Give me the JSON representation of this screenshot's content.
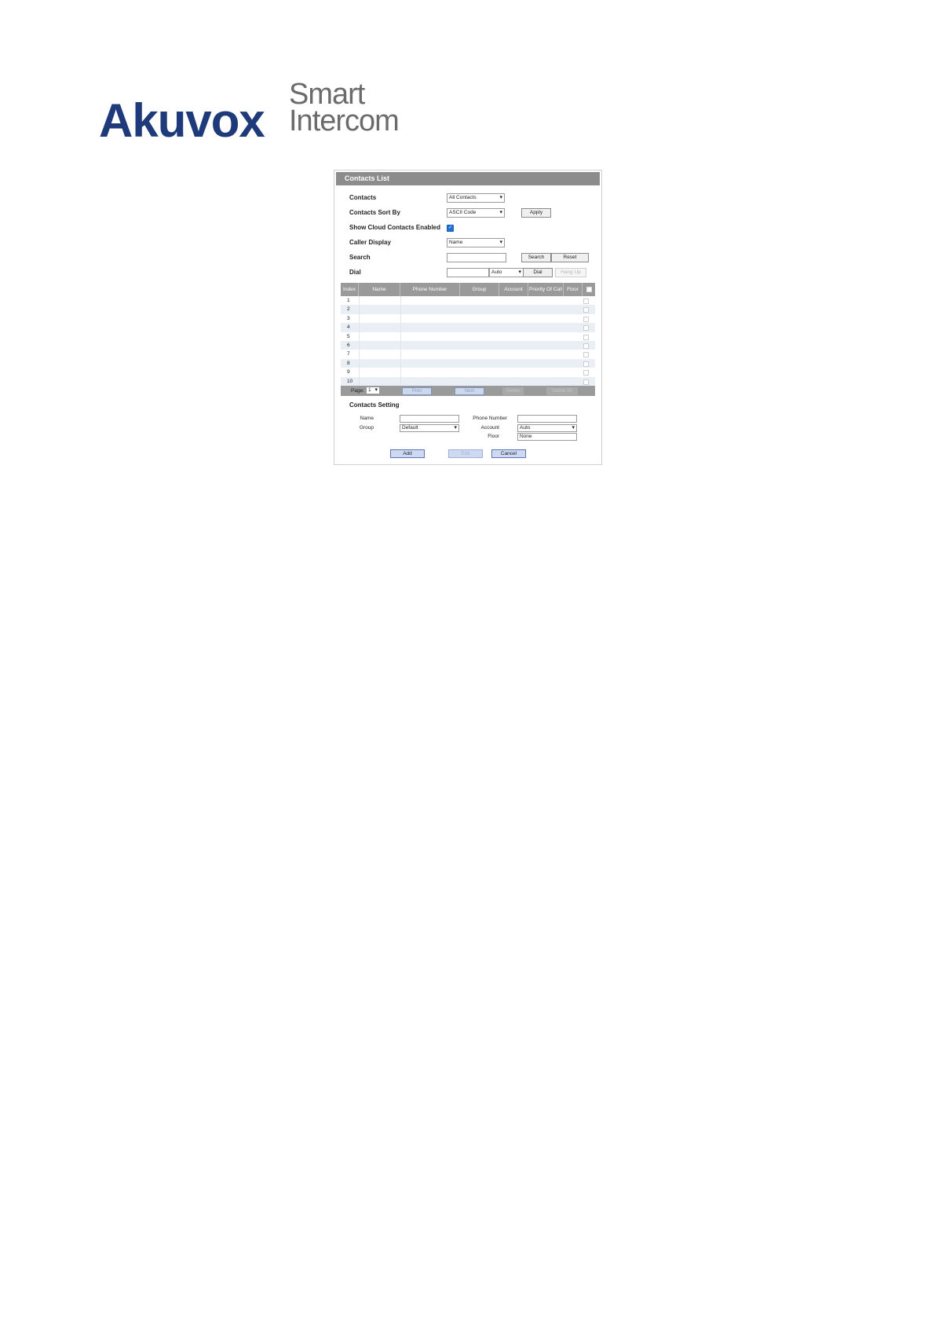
{
  "logo": {
    "brand": "Akuvox",
    "line1": "Smart",
    "line2": "Intercom"
  },
  "panel": {
    "title": "Contacts List",
    "form": {
      "contacts": {
        "label": "Contacts",
        "value": "All Contacts"
      },
      "sort_by": {
        "label": "Contacts Sort By",
        "value": "ASCII Code",
        "apply_label": "Apply"
      },
      "show_cloud": {
        "label": "Show Cloud Contacts Enabled",
        "checked": true
      },
      "caller_display": {
        "label": "Caller Display",
        "value": "Name"
      },
      "search": {
        "label": "Search",
        "value": "",
        "search_label": "Search",
        "reset_label": "Reset"
      },
      "dial": {
        "label": "Dial",
        "value": "",
        "account": "Auto",
        "dial_label": "Dial",
        "hangup_label": "Hang Up"
      }
    },
    "table": {
      "headers": [
        "Index",
        "Name",
        "Phone Number",
        "Group",
        "Account",
        "Priority Of Call",
        "Floor"
      ],
      "rows": [
        "1",
        "2",
        "3",
        "4",
        "5",
        "6",
        "7",
        "8",
        "9",
        "10"
      ]
    },
    "pager": {
      "page_label": "Page:",
      "page_value": "1",
      "prev_label": "Prev",
      "next_label": "Next",
      "delete_label": "Delete",
      "delete_all_label": "Delete All"
    },
    "contacts_setting": {
      "title": "Contacts Setting",
      "name_label": "Name",
      "name_value": "",
      "phone_label": "Phone Number",
      "phone_value": "",
      "group_label": "Group",
      "group_value": "Default",
      "account_label": "Account",
      "account_value": "Auto",
      "floor_label": "Floor",
      "floor_value": "None",
      "add_label": "Add",
      "edit_label": "Edit",
      "cancel_label": "Cancel"
    }
  },
  "colors": {
    "brand": "#1f3a7a",
    "header_gray": "#8c8c8c",
    "checkbox_blue": "#1e6fd9",
    "button_blue": "#cfd9f1"
  }
}
